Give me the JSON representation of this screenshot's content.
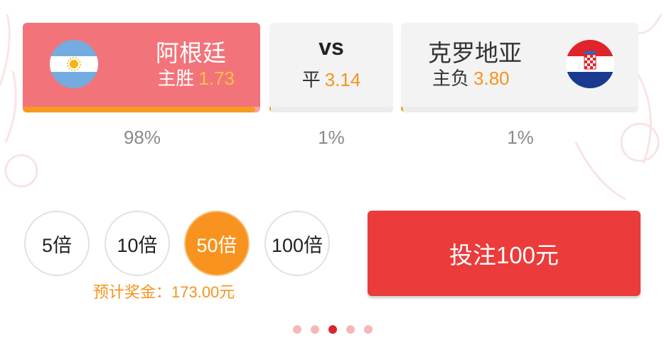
{
  "match": {
    "home": {
      "name": "阿根廷",
      "outcome_label": "主胜",
      "odds": "1.73",
      "percent": "98%",
      "vote_share": 0.98,
      "flag_icon": "argentina-flag-icon"
    },
    "draw": {
      "vs_label": "vs",
      "outcome_label": "平",
      "odds": "3.14",
      "percent": "1%",
      "vote_share": 0.01
    },
    "away": {
      "name": "克罗地亚",
      "outcome_label": "主负",
      "odds": "3.80",
      "percent": "1%",
      "vote_share": 0.01,
      "flag_icon": "croatia-flag-icon"
    },
    "selected": "home"
  },
  "multipliers": [
    {
      "label": "5倍",
      "active": false
    },
    {
      "label": "10倍",
      "active": false
    },
    {
      "label": "50倍",
      "active": true
    },
    {
      "label": "100倍",
      "active": false
    }
  ],
  "prize_text": "预计奖金：173.00元",
  "bet_button_label": "投注100元",
  "pager": {
    "count": 5,
    "active_index": 2
  },
  "colors": {
    "accent_orange": "#f7931e",
    "selected_card": "#f2747a",
    "bet_button": "#eb3b3b",
    "pager_active": "#d8262a",
    "pager_inactive": "#f4b8b8"
  }
}
